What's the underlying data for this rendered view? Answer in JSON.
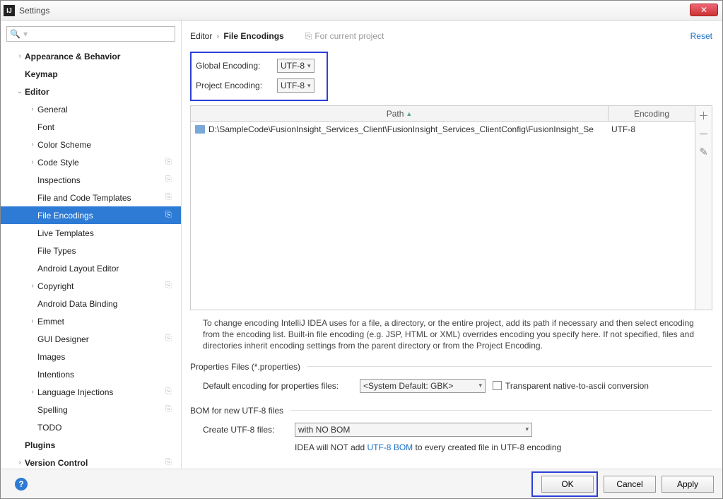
{
  "window": {
    "title": "Settings"
  },
  "search": {
    "placeholder": "Q"
  },
  "tree": {
    "items": [
      {
        "label": "Appearance & Behavior",
        "arrow": ">",
        "bold": true,
        "indent": 1
      },
      {
        "label": "Keymap",
        "arrow": "",
        "bold": true,
        "indent": 1
      },
      {
        "label": "Editor",
        "arrow": "v",
        "bold": true,
        "indent": 1
      },
      {
        "label": "General",
        "arrow": ">",
        "indent": 2
      },
      {
        "label": "Font",
        "arrow": "",
        "indent": 2
      },
      {
        "label": "Color Scheme",
        "arrow": ">",
        "indent": 2
      },
      {
        "label": "Code Style",
        "arrow": ">",
        "indent": 2,
        "copy": true
      },
      {
        "label": "Inspections",
        "arrow": "",
        "indent": 2,
        "copy": true
      },
      {
        "label": "File and Code Templates",
        "arrow": "",
        "indent": 2,
        "copy": true
      },
      {
        "label": "File Encodings",
        "arrow": "",
        "indent": 2,
        "copy": true,
        "selected": true
      },
      {
        "label": "Live Templates",
        "arrow": "",
        "indent": 2
      },
      {
        "label": "File Types",
        "arrow": "",
        "indent": 2
      },
      {
        "label": "Android Layout Editor",
        "arrow": "",
        "indent": 2
      },
      {
        "label": "Copyright",
        "arrow": ">",
        "indent": 2,
        "copy": true
      },
      {
        "label": "Android Data Binding",
        "arrow": "",
        "indent": 2
      },
      {
        "label": "Emmet",
        "arrow": ">",
        "indent": 2
      },
      {
        "label": "GUI Designer",
        "arrow": "",
        "indent": 2,
        "copy": true
      },
      {
        "label": "Images",
        "arrow": "",
        "indent": 2
      },
      {
        "label": "Intentions",
        "arrow": "",
        "indent": 2
      },
      {
        "label": "Language Injections",
        "arrow": ">",
        "indent": 2,
        "copy": true
      },
      {
        "label": "Spelling",
        "arrow": "",
        "indent": 2,
        "copy": true
      },
      {
        "label": "TODO",
        "arrow": "",
        "indent": 2
      },
      {
        "label": "Plugins",
        "arrow": "",
        "bold": true,
        "indent": 1
      },
      {
        "label": "Version Control",
        "arrow": ">",
        "bold": true,
        "indent": 1,
        "copy": true
      }
    ]
  },
  "breadcrumb": {
    "parent": "Editor",
    "current": "File Encodings",
    "projectHint": "For current project",
    "reset": "Reset"
  },
  "encodings": {
    "globalLabel": "Global Encoding:",
    "globalValue": "UTF-8",
    "projectLabel": "Project Encoding:",
    "projectValue": "UTF-8"
  },
  "table": {
    "headers": {
      "path": "Path",
      "encoding": "Encoding"
    },
    "rows": [
      {
        "path": "D:\\SampleCode\\FusionInsight_Services_Client\\FusionInsight_Services_ClientConfig\\FusionInsight_Se",
        "encoding": "UTF-8"
      }
    ]
  },
  "helpText": "To change encoding IntelliJ IDEA uses for a file, a directory, or the entire project, add its path if necessary and then select encoding from the encoding list. Built-in file encoding (e.g. JSP, HTML or XML) overrides encoding you specify here. If not specified, files and directories inherit encoding settings from the parent directory or from the Project Encoding.",
  "properties": {
    "header": "Properties Files (*.properties)",
    "defaultLabel": "Default encoding for properties files:",
    "defaultValue": "<System Default: GBK>",
    "transparentLabel": "Transparent native-to-ascii conversion"
  },
  "bom": {
    "header": "BOM for new UTF-8 files",
    "createLabel": "Create UTF-8 files:",
    "createValue": "with NO BOM",
    "hintPrefix": "IDEA will NOT add ",
    "hintLink": "UTF-8 BOM",
    "hintSuffix": " to every created file in UTF-8 encoding"
  },
  "footer": {
    "ok": "OK",
    "cancel": "Cancel",
    "apply": "Apply"
  }
}
